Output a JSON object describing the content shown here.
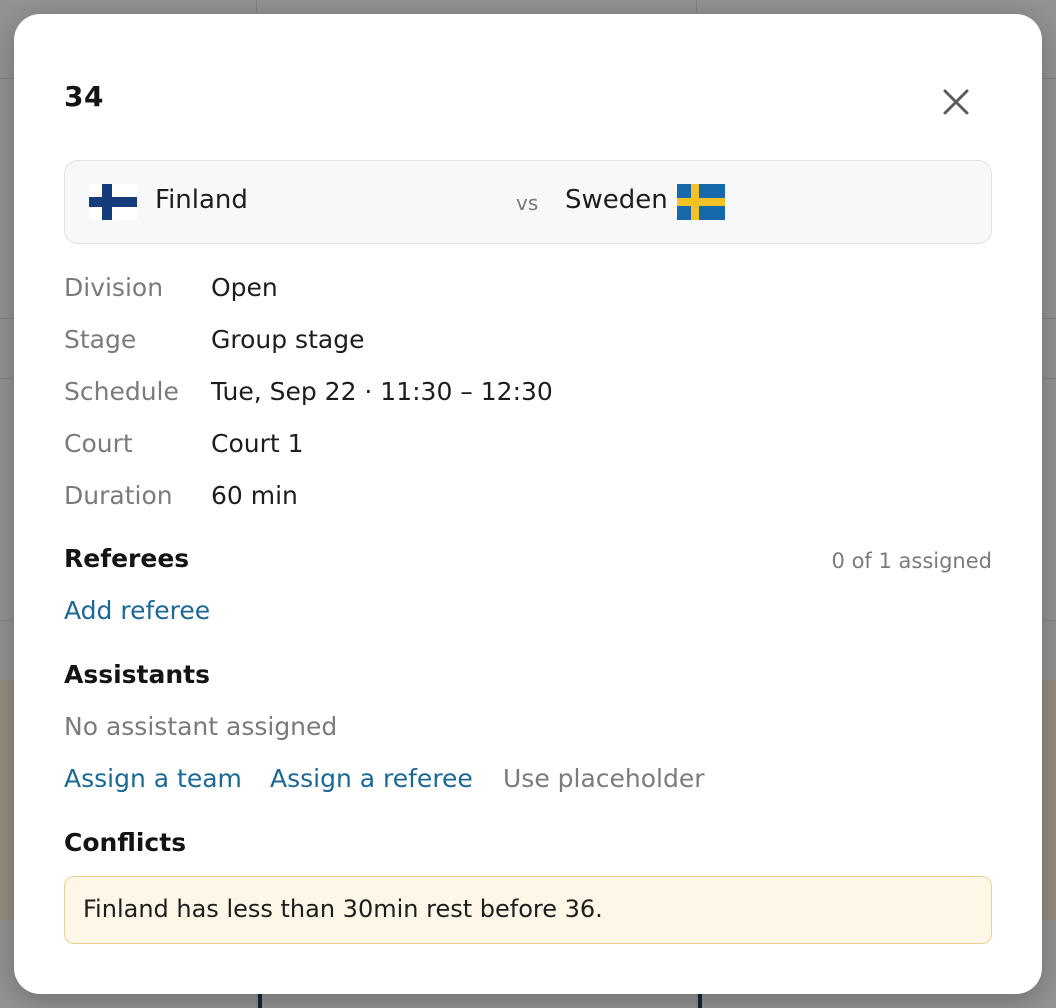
{
  "modal": {
    "title": "34",
    "close_icon": "close-icon"
  },
  "match": {
    "home_team": "Finland",
    "home_flag_icon": "finland-flag-icon",
    "vs_label": "vs",
    "away_team": "Sweden",
    "away_flag_icon": "sweden-flag-icon"
  },
  "details": [
    {
      "label": "Division",
      "value": "Open"
    },
    {
      "label": "Stage",
      "value": "Group stage"
    },
    {
      "label": "Schedule",
      "value": "Tue, Sep 22 · 11:30 – 12:30"
    },
    {
      "label": "Court",
      "value": "Court 1"
    },
    {
      "label": "Duration",
      "value": "60 min"
    }
  ],
  "referees": {
    "heading": "Referees",
    "assigned_count": "0 of 1 assigned",
    "add_link": "Add referee"
  },
  "assistants": {
    "heading": "Assistants",
    "empty_text": "No assistant assigned",
    "assign_team_link": "Assign a team",
    "assign_referee_link": "Assign a referee",
    "placeholder_link": "Use placeholder"
  },
  "conflicts": {
    "heading": "Conflicts",
    "items": [
      "Finland has less than 30min rest before 36."
    ]
  },
  "colors": {
    "link": "#1b6896",
    "muted": "#7b7b7b",
    "conflict_bg": "#fef6e6",
    "conflict_border": "#ecd08f",
    "finland_blue": "#143b7a",
    "sweden_blue": "#1769ab",
    "sweden_yellow": "#f4c323"
  }
}
